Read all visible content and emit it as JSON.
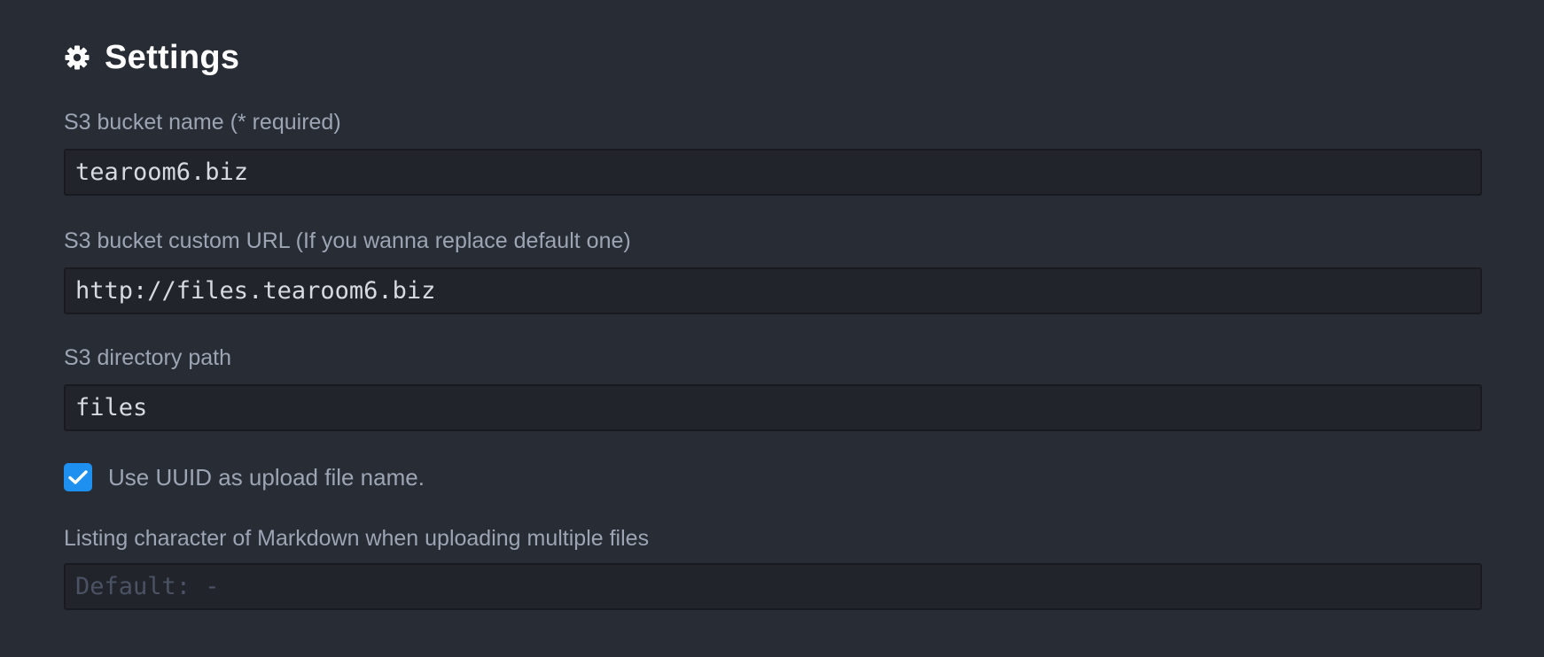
{
  "header": {
    "title": "Settings",
    "icon": "gear-icon"
  },
  "fields": {
    "bucket_name": {
      "label": "S3 bucket name (* required)",
      "value": "tearoom6.biz"
    },
    "custom_url": {
      "label": "S3 bucket custom URL (If you wanna replace default one)",
      "value": "http://files.tearoom6.biz"
    },
    "directory_path": {
      "label": "S3 directory path",
      "value": "files"
    },
    "use_uuid": {
      "label": "Use UUID as upload file name.",
      "checked": true
    },
    "listing_character": {
      "label": "Listing character of Markdown when uploading multiple files",
      "value": "",
      "placeholder": "Default: -"
    }
  },
  "colors": {
    "background": "#282c34",
    "input_background": "#21252b",
    "input_border": "#181a1f",
    "checkbox_accent": "#1e90f0",
    "title": "#ffffff",
    "label": "#9da5b4"
  }
}
